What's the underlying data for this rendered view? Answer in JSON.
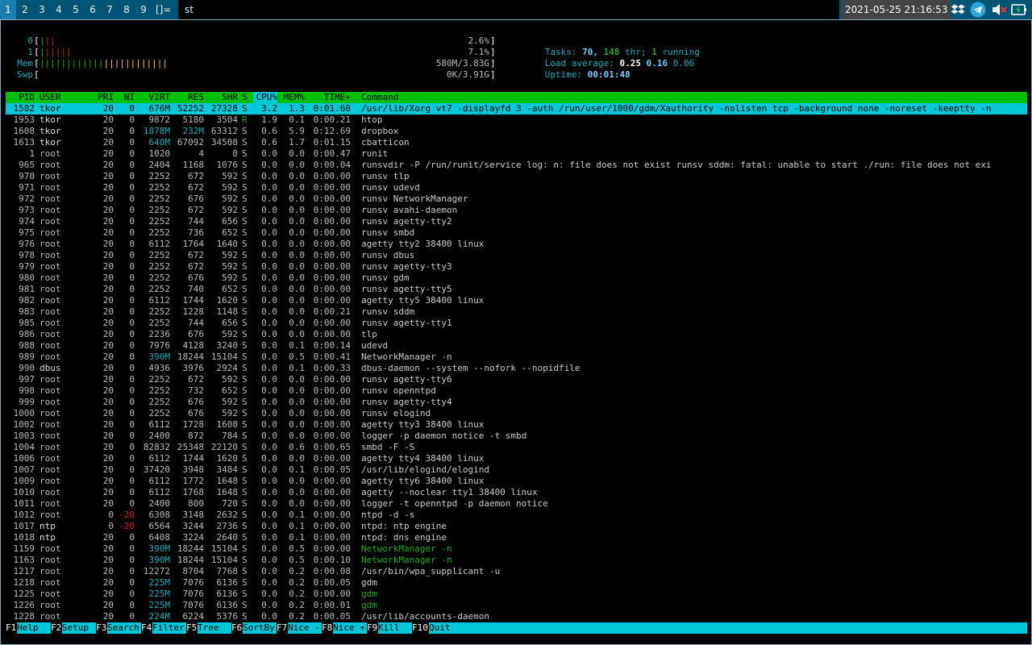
{
  "bar": {
    "tags": [
      "1",
      "2",
      "3",
      "4",
      "5",
      "6",
      "7",
      "8",
      "9"
    ],
    "selected_tag": "1",
    "layout": "[]=",
    "window_title": "st",
    "clock": "2021-05-25 21:16:53"
  },
  "meters": {
    "cpu0": {
      "label": "0",
      "value": "2.6%"
    },
    "cpu1": {
      "label": "1",
      "value": "7.1%"
    },
    "mem": {
      "label": "Mem",
      "value": "580M/3.83G"
    },
    "swp": {
      "label": "Swp",
      "value": "0K/3.91G"
    },
    "tasks": {
      "label": "Tasks:",
      "tasks": "70,",
      "thr_count": "148",
      "thr_label": "thr;",
      "running_count": "1",
      "running_label": "running"
    },
    "load": {
      "label": "Load average:",
      "l1": "0.25",
      "l5": "0.16",
      "l15": "0.06"
    },
    "uptime": {
      "label": "Uptime:",
      "value": "00:01:48"
    }
  },
  "table": {
    "headers": {
      "pid": "PID",
      "user": "USER",
      "pri": "PRI",
      "ni": "NI",
      "virt": "VIRT",
      "res": "RES",
      "shr": "SHR",
      "s": "S",
      "cpu": "CPU%",
      "mem": "MEM%",
      "time": "TIME+",
      "command": "Command"
    },
    "rows": [
      {
        "pid": "1582",
        "user": "tkor",
        "pri": "20",
        "ni": "0",
        "virt": "676M",
        "res": "52252",
        "shr": "27328",
        "s": "S",
        "cpu": "3.2",
        "mem": "1.3",
        "time": "0:01.68",
        "command": "/usr/lib/Xorg vt7 -displayfd 3 -auth /run/user/1000/gdm/Xauthority -nolisten tcp -background none -noreset -keeptty -n"
      },
      {
        "pid": "1953",
        "user": "tkor",
        "pri": "20",
        "ni": "0",
        "virt": "9872",
        "res": "5180",
        "shr": "3504",
        "s": "R",
        "cpu": "1.9",
        "mem": "0.1",
        "time": "0:00.21",
        "command": "htop"
      },
      {
        "pid": "1608",
        "user": "tkor",
        "pri": "20",
        "ni": "0",
        "virt": "1878M",
        "res": "232M",
        "shr": "63312",
        "s": "S",
        "cpu": "0.6",
        "mem": "5.9",
        "time": "0:12.69",
        "command": "dropbox"
      },
      {
        "pid": "1613",
        "user": "tkor",
        "pri": "20",
        "ni": "0",
        "virt": "640M",
        "res": "67092",
        "shr": "34508",
        "s": "S",
        "cpu": "0.6",
        "mem": "1.7",
        "time": "0:01.15",
        "command": "cbatticon"
      },
      {
        "pid": "1",
        "user": "root",
        "pri": "20",
        "ni": "0",
        "virt": "1020",
        "res": "4",
        "shr": "0",
        "s": "S",
        "cpu": "0.0",
        "mem": "0.0",
        "time": "0:00.47",
        "command": "runit"
      },
      {
        "pid": "965",
        "user": "root",
        "pri": "20",
        "ni": "0",
        "virt": "2404",
        "res": "1168",
        "shr": "1076",
        "s": "S",
        "cpu": "0.0",
        "mem": "0.0",
        "time": "0:00.04",
        "command": "runsvdir -P /run/runit/service log: n: file does not exist runsv sddm: fatal: unable to start ./run: file does not exi"
      },
      {
        "pid": "970",
        "user": "root",
        "pri": "20",
        "ni": "0",
        "virt": "2252",
        "res": "672",
        "shr": "592",
        "s": "S",
        "cpu": "0.0",
        "mem": "0.0",
        "time": "0:00.00",
        "command": "runsv tlp"
      },
      {
        "pid": "971",
        "user": "root",
        "pri": "20",
        "ni": "0",
        "virt": "2252",
        "res": "672",
        "shr": "592",
        "s": "S",
        "cpu": "0.0",
        "mem": "0.0",
        "time": "0:00.00",
        "command": "runsv udevd"
      },
      {
        "pid": "972",
        "user": "root",
        "pri": "20",
        "ni": "0",
        "virt": "2252",
        "res": "676",
        "shr": "592",
        "s": "S",
        "cpu": "0.0",
        "mem": "0.0",
        "time": "0:00.00",
        "command": "runsv NetworkManager"
      },
      {
        "pid": "973",
        "user": "root",
        "pri": "20",
        "ni": "0",
        "virt": "2252",
        "res": "672",
        "shr": "592",
        "s": "S",
        "cpu": "0.0",
        "mem": "0.0",
        "time": "0:00.00",
        "command": "runsv avahi-daemon"
      },
      {
        "pid": "974",
        "user": "root",
        "pri": "20",
        "ni": "0",
        "virt": "2252",
        "res": "744",
        "shr": "656",
        "s": "S",
        "cpu": "0.0",
        "mem": "0.0",
        "time": "0:00.00",
        "command": "runsv agetty-tty2"
      },
      {
        "pid": "975",
        "user": "root",
        "pri": "20",
        "ni": "0",
        "virt": "2252",
        "res": "736",
        "shr": "652",
        "s": "S",
        "cpu": "0.0",
        "mem": "0.0",
        "time": "0:00.00",
        "command": "runsv smbd"
      },
      {
        "pid": "976",
        "user": "root",
        "pri": "20",
        "ni": "0",
        "virt": "6112",
        "res": "1764",
        "shr": "1640",
        "s": "S",
        "cpu": "0.0",
        "mem": "0.0",
        "time": "0:00.00",
        "command": "agetty tty2 38400 linux"
      },
      {
        "pid": "978",
        "user": "root",
        "pri": "20",
        "ni": "0",
        "virt": "2252",
        "res": "672",
        "shr": "592",
        "s": "S",
        "cpu": "0.0",
        "mem": "0.0",
        "time": "0:00.00",
        "command": "runsv dbus"
      },
      {
        "pid": "979",
        "user": "root",
        "pri": "20",
        "ni": "0",
        "virt": "2252",
        "res": "672",
        "shr": "592",
        "s": "S",
        "cpu": "0.0",
        "mem": "0.0",
        "time": "0:00.00",
        "command": "runsv agetty-tty3"
      },
      {
        "pid": "980",
        "user": "root",
        "pri": "20",
        "ni": "0",
        "virt": "2252",
        "res": "676",
        "shr": "592",
        "s": "S",
        "cpu": "0.0",
        "mem": "0.0",
        "time": "0:00.00",
        "command": "runsv gdm"
      },
      {
        "pid": "981",
        "user": "root",
        "pri": "20",
        "ni": "0",
        "virt": "2252",
        "res": "740",
        "shr": "652",
        "s": "S",
        "cpu": "0.0",
        "mem": "0.0",
        "time": "0:00.00",
        "command": "runsv agetty-tty5"
      },
      {
        "pid": "982",
        "user": "root",
        "pri": "20",
        "ni": "0",
        "virt": "6112",
        "res": "1744",
        "shr": "1620",
        "s": "S",
        "cpu": "0.0",
        "mem": "0.0",
        "time": "0:00.00",
        "command": "agetty tty5 38400 linux"
      },
      {
        "pid": "983",
        "user": "root",
        "pri": "20",
        "ni": "0",
        "virt": "2252",
        "res": "1228",
        "shr": "1148",
        "s": "S",
        "cpu": "0.0",
        "mem": "0.0",
        "time": "0:00.21",
        "command": "runsv sddm"
      },
      {
        "pid": "985",
        "user": "root",
        "pri": "20",
        "ni": "0",
        "virt": "2252",
        "res": "744",
        "shr": "656",
        "s": "S",
        "cpu": "0.0",
        "mem": "0.0",
        "time": "0:00.00",
        "command": "runsv agetty-tty1"
      },
      {
        "pid": "986",
        "user": "root",
        "pri": "20",
        "ni": "0",
        "virt": "2236",
        "res": "676",
        "shr": "592",
        "s": "S",
        "cpu": "0.0",
        "mem": "0.0",
        "time": "0:00.00",
        "command": "tlp"
      },
      {
        "pid": "988",
        "user": "root",
        "pri": "20",
        "ni": "0",
        "virt": "7976",
        "res": "4128",
        "shr": "3240",
        "s": "S",
        "cpu": "0.0",
        "mem": "0.1",
        "time": "0:00.14",
        "command": "udevd"
      },
      {
        "pid": "989",
        "user": "root",
        "pri": "20",
        "ni": "0",
        "virt": "390M",
        "res": "18244",
        "shr": "15104",
        "s": "S",
        "cpu": "0.0",
        "mem": "0.5",
        "time": "0:00.41",
        "command": "NetworkManager -n"
      },
      {
        "pid": "990",
        "user": "dbus",
        "pri": "20",
        "ni": "0",
        "virt": "4936",
        "res": "3976",
        "shr": "2924",
        "s": "S",
        "cpu": "0.0",
        "mem": "0.1",
        "time": "0:00.33",
        "command": "dbus-daemon --system --nofork --nopidfile"
      },
      {
        "pid": "997",
        "user": "root",
        "pri": "20",
        "ni": "0",
        "virt": "2252",
        "res": "672",
        "shr": "592",
        "s": "S",
        "cpu": "0.0",
        "mem": "0.0",
        "time": "0:00.00",
        "command": "runsv agetty-tty6"
      },
      {
        "pid": "998",
        "user": "root",
        "pri": "20",
        "ni": "0",
        "virt": "2252",
        "res": "732",
        "shr": "652",
        "s": "S",
        "cpu": "0.0",
        "mem": "0.0",
        "time": "0:00.00",
        "command": "runsv openntpd"
      },
      {
        "pid": "999",
        "user": "root",
        "pri": "20",
        "ni": "0",
        "virt": "2252",
        "res": "676",
        "shr": "592",
        "s": "S",
        "cpu": "0.0",
        "mem": "0.0",
        "time": "0:00.00",
        "command": "runsv agetty-tty4"
      },
      {
        "pid": "1000",
        "user": "root",
        "pri": "20",
        "ni": "0",
        "virt": "2252",
        "res": "676",
        "shr": "592",
        "s": "S",
        "cpu": "0.0",
        "mem": "0.0",
        "time": "0:00.00",
        "command": "runsv elogind"
      },
      {
        "pid": "1002",
        "user": "root",
        "pri": "20",
        "ni": "0",
        "virt": "6112",
        "res": "1728",
        "shr": "1608",
        "s": "S",
        "cpu": "0.0",
        "mem": "0.0",
        "time": "0:00.00",
        "command": "agetty tty3 38400 linux"
      },
      {
        "pid": "1003",
        "user": "root",
        "pri": "20",
        "ni": "0",
        "virt": "2400",
        "res": "872",
        "shr": "784",
        "s": "S",
        "cpu": "0.0",
        "mem": "0.0",
        "time": "0:00.00",
        "command": "logger -p daemon notice -t smbd"
      },
      {
        "pid": "1004",
        "user": "root",
        "pri": "20",
        "ni": "0",
        "virt": "82832",
        "res": "25348",
        "shr": "22120",
        "s": "S",
        "cpu": "0.0",
        "mem": "0.6",
        "time": "0:00.65",
        "command": "smbd -F -S"
      },
      {
        "pid": "1006",
        "user": "root",
        "pri": "20",
        "ni": "0",
        "virt": "6112",
        "res": "1744",
        "shr": "1620",
        "s": "S",
        "cpu": "0.0",
        "mem": "0.0",
        "time": "0:00.00",
        "command": "agetty tty4 38400 linux"
      },
      {
        "pid": "1007",
        "user": "root",
        "pri": "20",
        "ni": "0",
        "virt": "37420",
        "res": "3948",
        "shr": "3484",
        "s": "S",
        "cpu": "0.0",
        "mem": "0.1",
        "time": "0:00.05",
        "command": "/usr/lib/elogind/elogind"
      },
      {
        "pid": "1009",
        "user": "root",
        "pri": "20",
        "ni": "0",
        "virt": "6112",
        "res": "1772",
        "shr": "1648",
        "s": "S",
        "cpu": "0.0",
        "mem": "0.0",
        "time": "0:00.00",
        "command": "agetty tty6 38400 linux"
      },
      {
        "pid": "1010",
        "user": "root",
        "pri": "20",
        "ni": "0",
        "virt": "6112",
        "res": "1768",
        "shr": "1648",
        "s": "S",
        "cpu": "0.0",
        "mem": "0.0",
        "time": "0:00.00",
        "command": "agetty --noclear tty1 38400 linux"
      },
      {
        "pid": "1011",
        "user": "root",
        "pri": "20",
        "ni": "0",
        "virt": "2400",
        "res": "800",
        "shr": "720",
        "s": "S",
        "cpu": "0.0",
        "mem": "0.0",
        "time": "0:00.00",
        "command": "logger -t openntpd -p daemon notice"
      },
      {
        "pid": "1012",
        "user": "root",
        "pri": "0",
        "ni": "-20",
        "virt": "6308",
        "res": "3148",
        "shr": "2632",
        "s": "S",
        "cpu": "0.0",
        "mem": "0.1",
        "time": "0:00.00",
        "command": "ntpd -d -s"
      },
      {
        "pid": "1017",
        "user": "ntp",
        "pri": "0",
        "ni": "-20",
        "virt": "6564",
        "res": "3244",
        "shr": "2736",
        "s": "S",
        "cpu": "0.0",
        "mem": "0.1",
        "time": "0:00.00",
        "command": "ntpd: ntp engine"
      },
      {
        "pid": "1018",
        "user": "ntp",
        "pri": "20",
        "ni": "0",
        "virt": "6408",
        "res": "3224",
        "shr": "2640",
        "s": "S",
        "cpu": "0.0",
        "mem": "0.1",
        "time": "0:00.00",
        "command": "ntpd: dns engine"
      },
      {
        "pid": "1159",
        "user": "root",
        "pri": "20",
        "ni": "0",
        "virt": "390M",
        "res": "18244",
        "shr": "15104",
        "s": "S",
        "cpu": "0.0",
        "mem": "0.5",
        "time": "0:00.00",
        "command": "NetworkManager -n"
      },
      {
        "pid": "1163",
        "user": "root",
        "pri": "20",
        "ni": "0",
        "virt": "390M",
        "res": "18244",
        "shr": "15104",
        "s": "S",
        "cpu": "0.0",
        "mem": "0.5",
        "time": "0:00.10",
        "command": "NetworkManager -n"
      },
      {
        "pid": "1217",
        "user": "root",
        "pri": "20",
        "ni": "0",
        "virt": "12272",
        "res": "8704",
        "shr": "7768",
        "s": "S",
        "cpu": "0.0",
        "mem": "0.2",
        "time": "0:00.08",
        "command": "/usr/bin/wpa_supplicant -u"
      },
      {
        "pid": "1218",
        "user": "root",
        "pri": "20",
        "ni": "0",
        "virt": "225M",
        "res": "7076",
        "shr": "6136",
        "s": "S",
        "cpu": "0.0",
        "mem": "0.2",
        "time": "0:00.05",
        "command": "gdm"
      },
      {
        "pid": "1225",
        "user": "root",
        "pri": "20",
        "ni": "0",
        "virt": "225M",
        "res": "7076",
        "shr": "6136",
        "s": "S",
        "cpu": "0.0",
        "mem": "0.2",
        "time": "0:00.00",
        "command": "gdm"
      },
      {
        "pid": "1226",
        "user": "root",
        "pri": "20",
        "ni": "0",
        "virt": "225M",
        "res": "7076",
        "shr": "6136",
        "s": "S",
        "cpu": "0.0",
        "mem": "0.2",
        "time": "0:00.01",
        "command": "gdm"
      },
      {
        "pid": "1228",
        "user": "root",
        "pri": "20",
        "ni": "0",
        "virt": "224M",
        "res": "6224",
        "shr": "5376",
        "s": "S",
        "cpu": "0.0",
        "mem": "0.2",
        "time": "0:00.05",
        "command": "/usr/lib/accounts-daemon"
      }
    ]
  },
  "fkeys": [
    {
      "key": "F1",
      "label": "Help"
    },
    {
      "key": "F2",
      "label": "Setup"
    },
    {
      "key": "F3",
      "label": "Search"
    },
    {
      "key": "F4",
      "label": "Filter"
    },
    {
      "key": "F5",
      "label": "Tree"
    },
    {
      "key": "F6",
      "label": "SortBy"
    },
    {
      "key": "F7",
      "label": "Nice -"
    },
    {
      "key": "F8",
      "label": "Nice +"
    },
    {
      "key": "F9",
      "label": "Kill"
    },
    {
      "key": "F10",
      "label": "Quit"
    }
  ],
  "colors": {
    "bar_bg": "#005577",
    "header_green": "#00c000",
    "highlight_cyan": "#00c8d8",
    "thread_green": "#2a2"
  },
  "tray_icons": [
    "dropbox-icon",
    "telegram-icon",
    "volume-muted-icon",
    "battery-icon"
  ]
}
